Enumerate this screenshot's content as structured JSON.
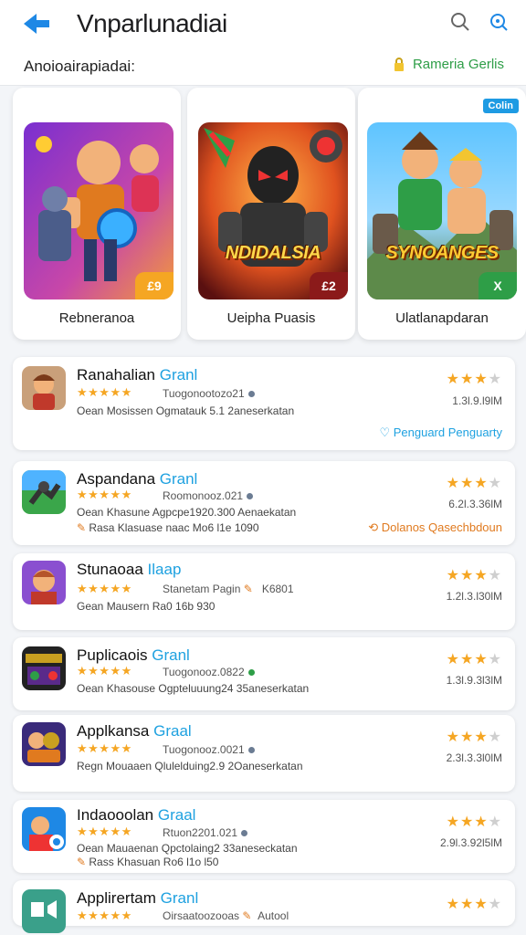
{
  "header": {
    "title": "Vnparlunadiai",
    "icons": [
      "back-arrow-icon",
      "search-icon",
      "search-alt-icon"
    ]
  },
  "subbar": {
    "title": "Anoioairapiadai:",
    "right_label": "Rameria Gerlis"
  },
  "featured": [
    {
      "name": "Rebneranoa",
      "corner": "£9",
      "corner_color": "#f5a623"
    },
    {
      "name": "Ueipha Puasis",
      "art_text": "NDIDALSIA",
      "corner": "£2",
      "corner_color": "#8b1a1a"
    },
    {
      "name": "Ulatlanapdaran",
      "badge": "Colin",
      "art_text": "SYNOANGES",
      "corner": "X",
      "corner_color": "#2e9e47"
    }
  ],
  "list": [
    {
      "name": "Ranahalian",
      "tag": "Granl",
      "stars": "★★★★★",
      "meta": "Tuogonootozo21",
      "desc": "Oean Mosissen Ogmatauk 5.1 2aneserkatan",
      "extra": "",
      "right_size": "1.3l.9.l9lM",
      "action": "Penguard Penguarty",
      "action_color": "#1ea1e0"
    },
    {
      "name": "Aspandana",
      "tag": "Granl",
      "stars": "★★★★★",
      "meta": "Roomonooz.021",
      "desc": "Oean Khasune Agpcpe1920.300 Aenaekatan",
      "extra": "Rasa Klasuase naac Mo6 l1e 1090",
      "right_size": "6.2l.3.36lM",
      "action": "Dolanos Qasechbdoun",
      "action_color": "#e07a1f"
    },
    {
      "name": "Stunaoaa",
      "tag": "Ilaap",
      "stars": "★★★★★",
      "meta": "Stanetam Pagin",
      "meta2": "K6801",
      "desc": "Gean Mausern Ra0 16b 930",
      "extra": "",
      "right_size": "1.2l.3.l30lM",
      "action": ""
    },
    {
      "name": "Puplicaois",
      "tag": "Granl",
      "stars": "★★★★★",
      "meta": "Tuogonooz.0822",
      "desc": "Oean Khasouse Ogpteluuung24 35aneserkatan",
      "extra": "",
      "right_size": "1.3l.9.3l3lM",
      "action": ""
    },
    {
      "name": "Applkansa",
      "tag": "Graal",
      "stars": "★★★★★",
      "meta": "Tuogonooz.0021",
      "desc": "Regn Mouaaen Qlulelduing2.9 2Oaneserkatan",
      "extra": "",
      "right_size": "2.3l.3.3l0lM",
      "action": ""
    },
    {
      "name": "Indaooolan",
      "tag": "Graal",
      "stars": "★★★★★",
      "meta": "Rtuon2201.021",
      "desc": "Oean Mauaenan Qpctolaing2 33aneseckatan",
      "extra": "Rass Khasuan Ro6 l1o l50",
      "right_size": "2.9l.3.92l5lM",
      "action": ""
    },
    {
      "name": "Applirertam",
      "tag": "Granl",
      "stars": "★★★★★",
      "meta": "Oirsaatoozooas",
      "meta2": "Autool",
      "desc": "",
      "extra": "",
      "right_size": "",
      "action": ""
    }
  ],
  "colors": {
    "accent": "#1ea1e0",
    "star": "#f5a623",
    "green": "#2e9e47"
  }
}
